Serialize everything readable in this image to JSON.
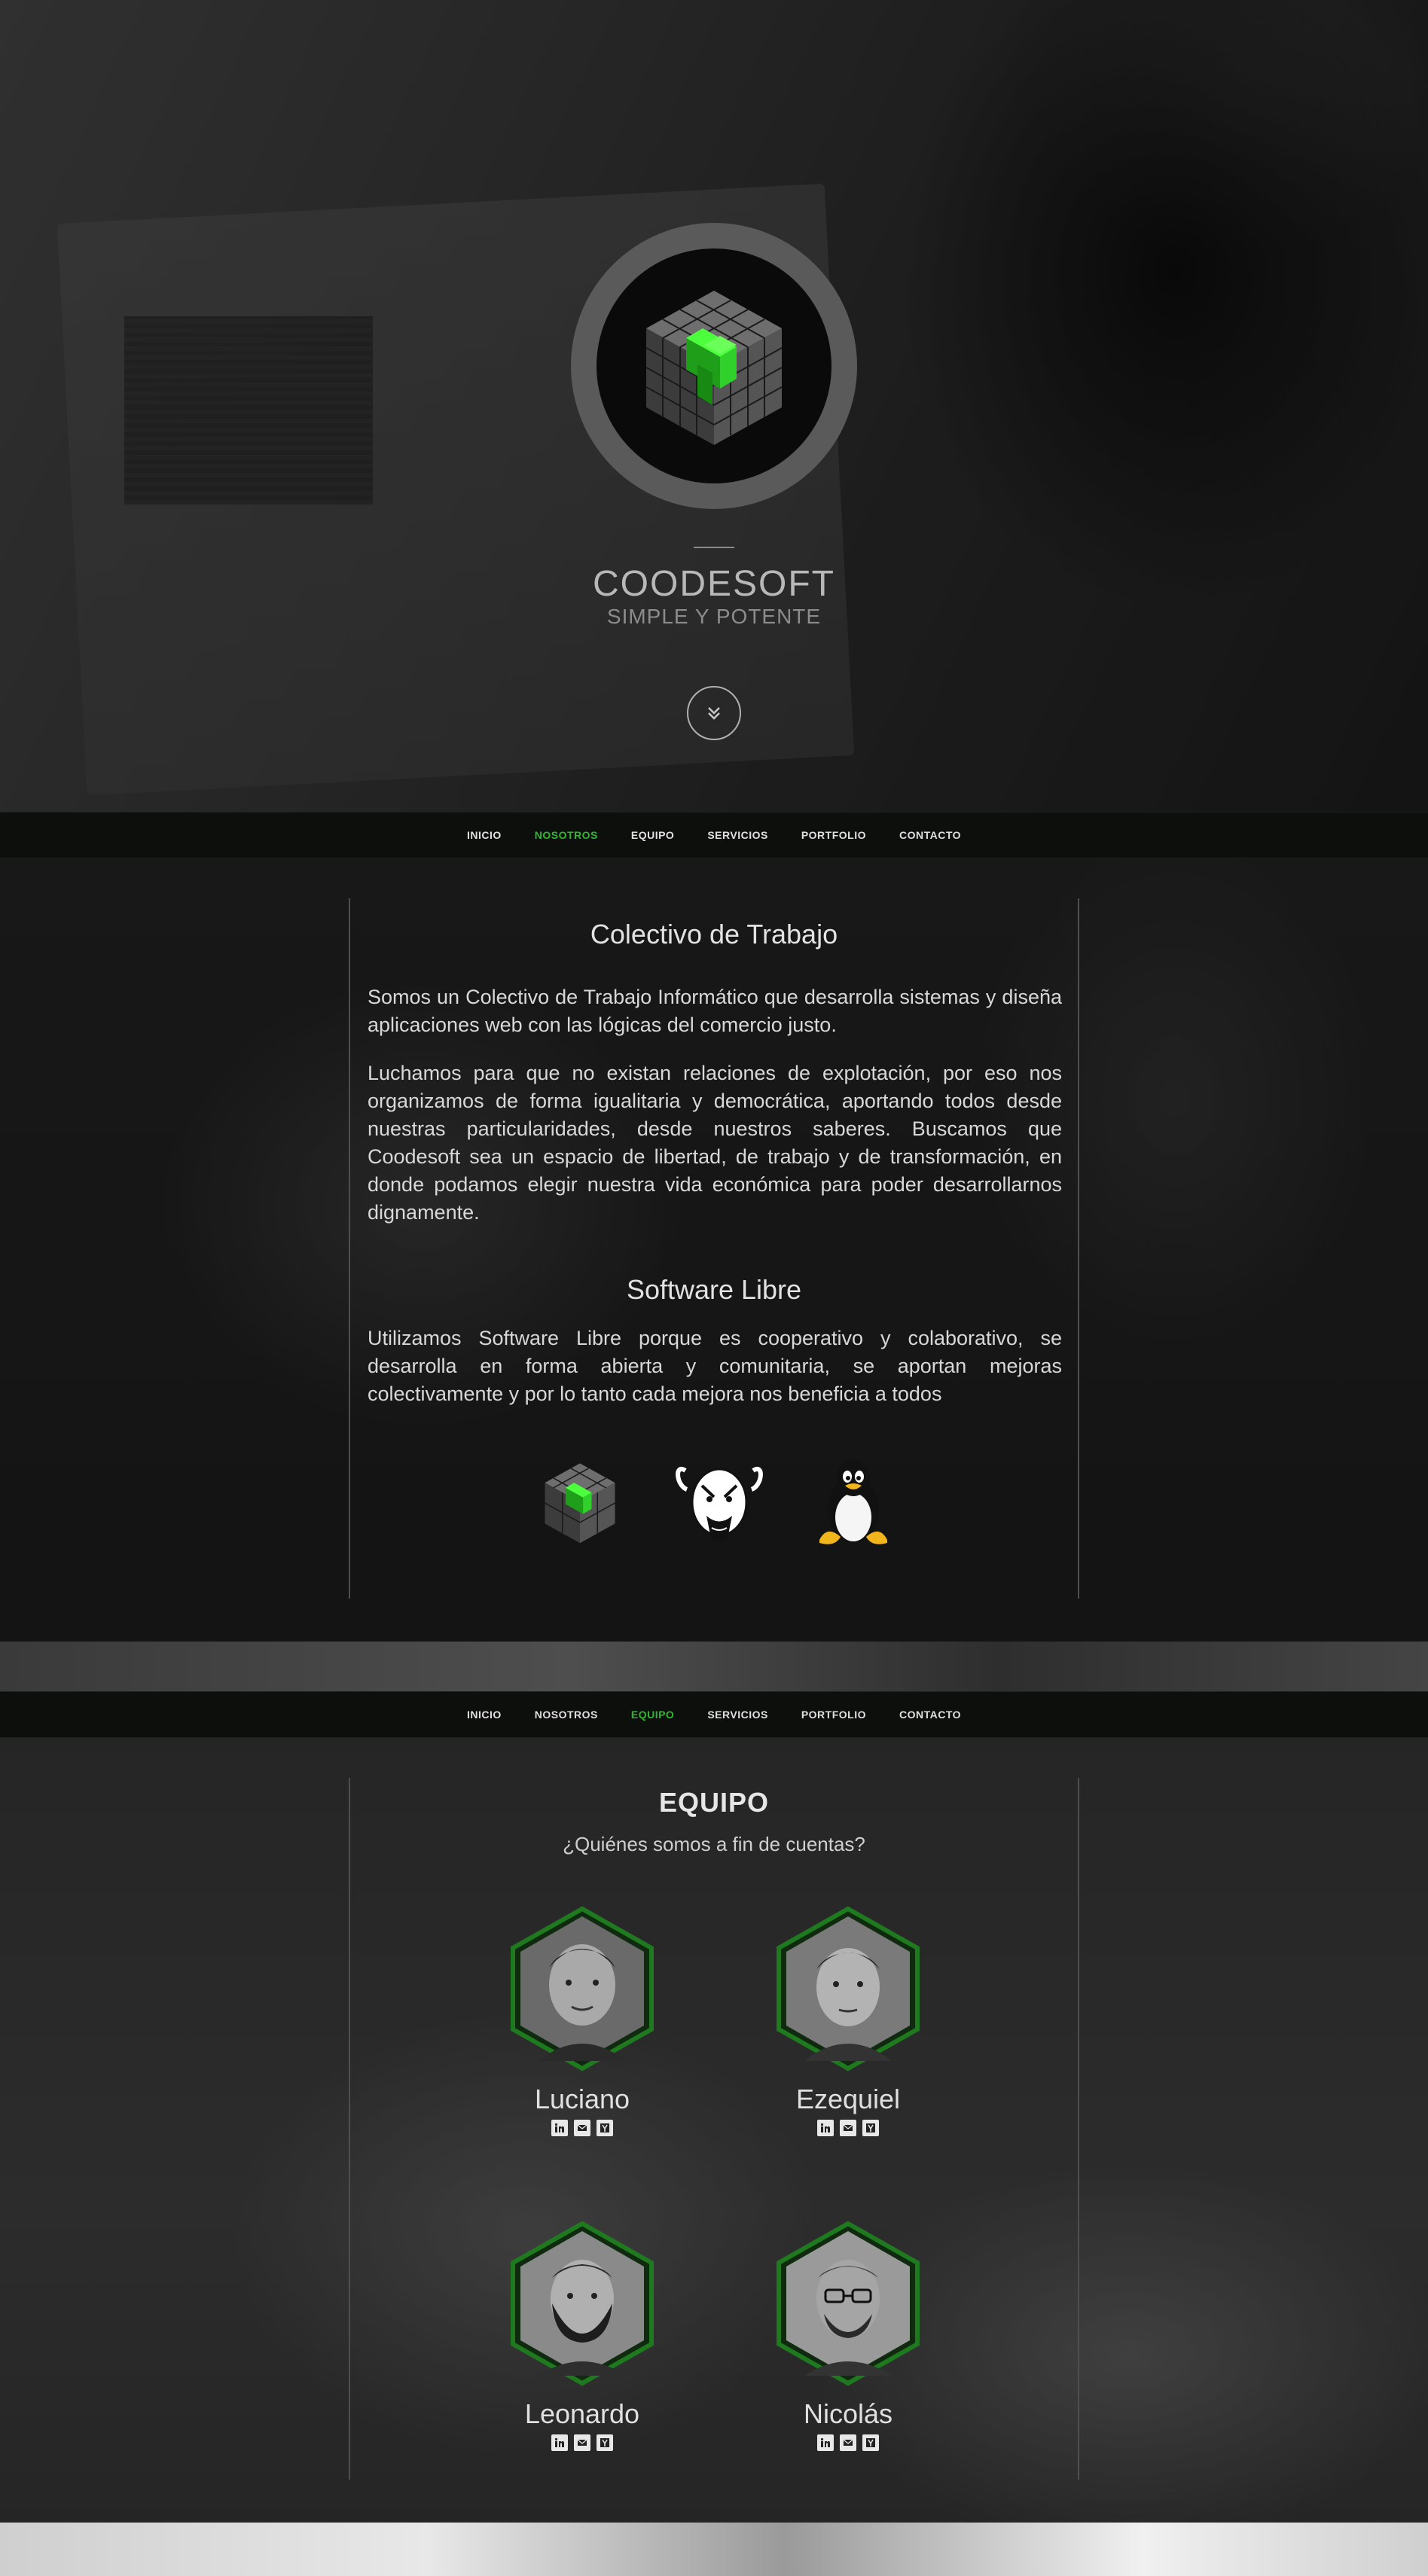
{
  "hero": {
    "title": "COODESOFT",
    "subtitle": "SIMPLE Y POTENTE"
  },
  "nav": {
    "items": [
      {
        "label": "INICIO"
      },
      {
        "label": "NOSOTROS"
      },
      {
        "label": "EQUIPO"
      },
      {
        "label": "SERVICIOS"
      },
      {
        "label": "PORTFOLIO"
      },
      {
        "label": "CONTACTO"
      }
    ],
    "active_first": "NOSOTROS",
    "active_second": "EQUIPO"
  },
  "about": {
    "heading": "Colectivo de Trabajo",
    "p1": "Somos un Colectivo de Trabajo Informático que desarrolla sistemas  y diseña  aplicaciones  web  con las  lógicas  del comercio justo.",
    "p2": "Luchamos para que no existan relaciones de explotación, por  eso  nos organizamos  de forma igualitaria y  democrática, aportando  todos desde nuestras  particularidades,  desde nuestros  saberes.  Buscamos que  Coodesoft  sea  un  espacio  de  libertad,  de  trabajo  y  de transformación, en donde  podamos elegir nuestra vida  económica para poder desarrollarnos dignamente.",
    "heading2": "Software Libre",
    "p3": "Utilizamos Software Libre porque es cooperativo y colaborativo, se desarrolla  en  forma  abierta  y  comunitaria,  se  aportan  mejoras colectivamente  y por lo tanto cada mejora nos beneficia a todos",
    "logos": [
      "coodesoft-cube-icon",
      "gnu-icon",
      "tux-icon"
    ]
  },
  "team": {
    "title": "EQUIPO",
    "subtitle": "¿Quiénes somos a fin de cuentas?",
    "members": [
      {
        "name": "Luciano"
      },
      {
        "name": "Ezequiel"
      },
      {
        "name": "Leonardo"
      },
      {
        "name": "Nicolás"
      }
    ],
    "social_icons": [
      "linkedin-icon",
      "mail-icon",
      "ycombinator-icon"
    ]
  },
  "colors": {
    "accent": "#2fb82f",
    "nav_bg": "#0d0f0d",
    "hex_border": "#1f7a1f"
  }
}
